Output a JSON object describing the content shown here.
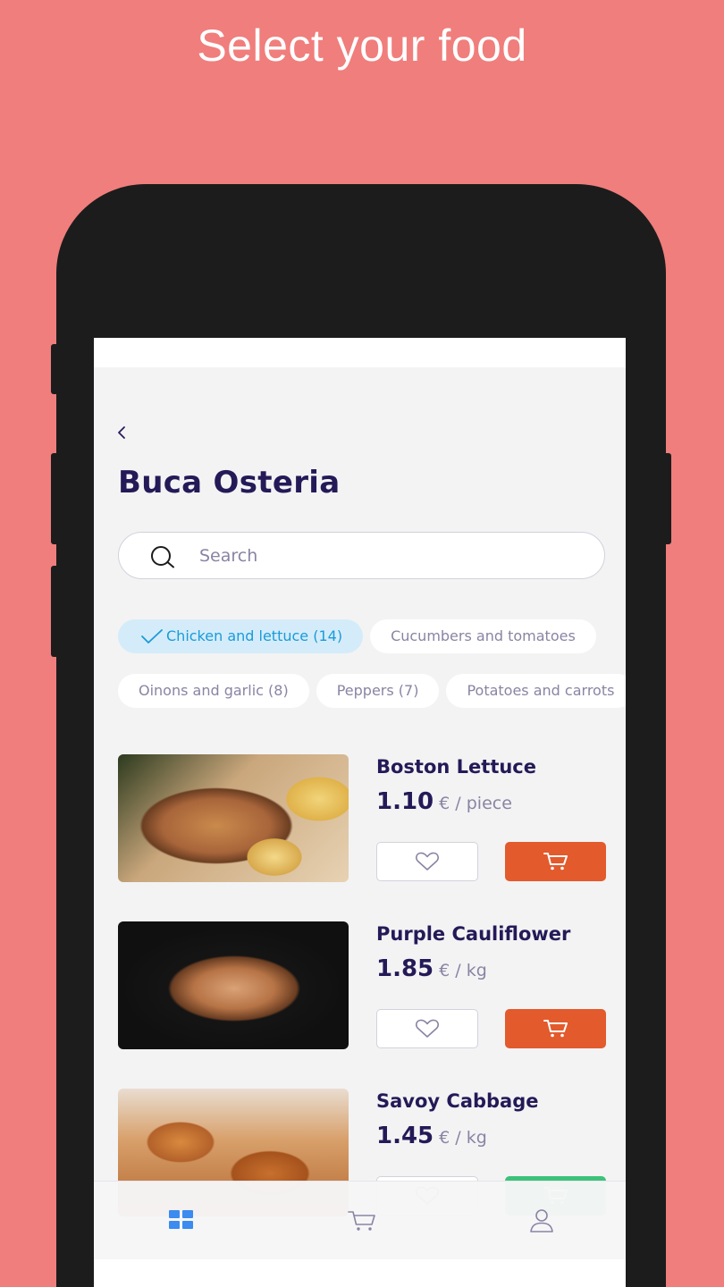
{
  "headline": "Select your food",
  "restaurant": {
    "title": "Buca Osteria"
  },
  "search": {
    "placeholder": "Search"
  },
  "filters": {
    "row1": [
      {
        "label": "Chicken and lettuce (14)",
        "selected": true
      },
      {
        "label": "Cucumbers and tomatoes",
        "selected": false
      }
    ],
    "row2": [
      {
        "label": "Oinons and garlic (8)",
        "selected": false
      },
      {
        "label": "Peppers (7)",
        "selected": false
      },
      {
        "label": "Potatoes and carrots",
        "selected": false
      }
    ]
  },
  "products": [
    {
      "name": "Boston Lettuce",
      "price": "1.10",
      "unit": "€ / piece"
    },
    {
      "name": "Purple Cauliflower",
      "price": "1.85",
      "unit": "€ / kg"
    },
    {
      "name": "Savoy Cabbage",
      "price": "1.45",
      "unit": "€ / kg"
    }
  ],
  "tabs": [
    {
      "name": "home",
      "icon": "grid-icon",
      "active": true
    },
    {
      "name": "cart",
      "icon": "cart-icon",
      "active": false
    },
    {
      "name": "profile",
      "icon": "user-icon",
      "active": false
    }
  ],
  "colors": {
    "background": "#f07e7c",
    "title": "#241a57",
    "accent_orange": "#e35a2d",
    "accent_green": "#3cc27a",
    "chip_active_bg": "#d4ecfa",
    "chip_active_text": "#1a9bd8",
    "tab_active": "#3b8bf0"
  }
}
